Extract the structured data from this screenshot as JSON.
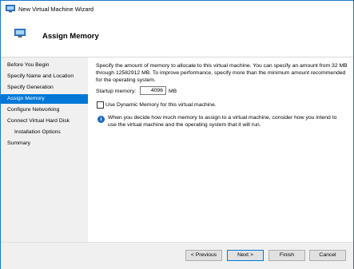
{
  "window": {
    "title": "New Virtual Machine Wizard"
  },
  "header": {
    "title": "Assign Memory"
  },
  "sidebar": {
    "items": [
      {
        "label": "Before You Begin"
      },
      {
        "label": "Specify Name and Location"
      },
      {
        "label": "Specify Generation"
      },
      {
        "label": "Assign Memory"
      },
      {
        "label": "Configure Networking"
      },
      {
        "label": "Connect Virtual Hard Disk"
      },
      {
        "label": "Installation Options"
      },
      {
        "label": "Summary"
      }
    ],
    "selected": "Assign Memory"
  },
  "main": {
    "description": "Specify the amount of memory to allocate to this virtual machine. You can specify an amount from 32 MB through 12582912 MB. To improve performance, specify more than the minimum amount recommended for the operating system.",
    "startup_memory": {
      "label": "Startup memory:",
      "value": "4096",
      "unit": "MB"
    },
    "dynamic_memory": {
      "label": "Use Dynamic Memory for this virtual machine.",
      "checked": false
    },
    "info_text": "When you decide how much memory to assign to a virtual machine, consider how you intend to use the virtual machine and the operating system that it will run."
  },
  "buttons": {
    "previous": "< Previous",
    "next": "Next >",
    "finish": "Finish",
    "cancel": "Cancel"
  },
  "colors": {
    "accent": "#0078d7",
    "info": "#1c6cc7",
    "border": "#1979ca"
  }
}
